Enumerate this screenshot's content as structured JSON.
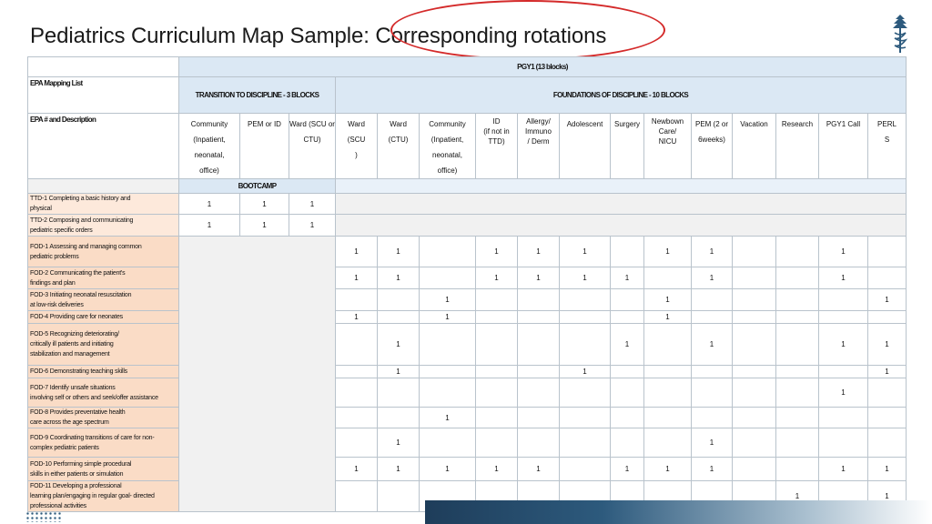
{
  "title": "Pediatrics Curriculum Map Sample: Corresponding rotations",
  "pgy_header": "PGY1 (13 blocks)",
  "epa_mapping_list": "EPA Mapping List",
  "ttd_header": "TRANSITION TO DISCIPLINE - 3 BLOCKS",
  "fod_header": "FOUNDATIONS OF DISCIPLINE - 10 BLOCKS",
  "epa_desc_header": "EPA # and Description",
  "bootcamp": "BOOTCAMP",
  "rotations": [
    {
      "lines": [
        "Community",
        "(Inpatient,",
        "neonatal,",
        "office)"
      ]
    },
    {
      "lines": [
        "PEM or ID"
      ]
    },
    {
      "lines": [
        "Ward (SCU or",
        "CTU)"
      ]
    },
    {
      "lines": [
        "Ward",
        "(SCU",
        ")"
      ]
    },
    {
      "lines": [
        "Ward",
        "(CTU)"
      ]
    },
    {
      "lines": [
        "Community",
        "(Inpatient,",
        "neonatal,",
        "office)"
      ]
    },
    {
      "lines": [
        "ID",
        "(if not in",
        "TTD)"
      ]
    },
    {
      "lines": [
        "Allergy/",
        "Immuno",
        "/ Derm"
      ]
    },
    {
      "lines": [
        "Adolescent"
      ]
    },
    {
      "lines": [
        "Surgery"
      ]
    },
    {
      "lines": [
        "Newbown",
        "Care/",
        "NICU"
      ]
    },
    {
      "lines": [
        "PEM (2 or",
        "6weeks)"
      ]
    },
    {
      "lines": [
        "Vacation"
      ]
    },
    {
      "lines": [
        "Research"
      ]
    },
    {
      "lines": [
        "PGY1 Call"
      ]
    },
    {
      "lines": [
        "PERL",
        "S"
      ]
    }
  ],
  "epas": [
    {
      "desc": [
        "TTD-1 Completing a basic history and",
        "physical"
      ],
      "vals": [
        "1",
        "1",
        "1"
      ]
    },
    {
      "desc": [
        "TTD-2 Composing and communicating",
        "pediatric specific orders"
      ],
      "vals": [
        "1",
        "1",
        "1"
      ]
    },
    {
      "desc": [
        "FOD-1 Assessing and managing common",
        "pediatric problems"
      ],
      "vals": [
        "",
        "",
        "",
        "1",
        "1",
        "",
        "1",
        "1",
        "1",
        "",
        "1",
        "1",
        "",
        "",
        "1",
        ""
      ]
    },
    {
      "desc": [
        "FOD-2 Communicating the patient's",
        "findings and plan"
      ],
      "vals": [
        "",
        "",
        "",
        "1",
        "1",
        "",
        "1",
        "1",
        "1",
        "1",
        "",
        "1",
        "",
        "",
        "1",
        ""
      ]
    },
    {
      "desc": [
        "FOD-3 Initiating neonatal resuscitation",
        "at low-risk deliveries"
      ],
      "vals": [
        "",
        "",
        "",
        "",
        "",
        "1",
        "",
        "",
        "",
        "",
        "1",
        "",
        "",
        "",
        "",
        "1"
      ]
    },
    {
      "desc": [
        "FOD-4 Providing care for neonates"
      ],
      "vals": [
        "",
        "",
        "",
        "1",
        "",
        "1",
        "",
        "",
        "",
        "",
        "1",
        "",
        "",
        "",
        "",
        ""
      ]
    },
    {
      "desc": [
        "FOD-5 Recognizing deteriorating/",
        "critically ill patients and initiating",
        "stabilization and management"
      ],
      "vals": [
        "",
        "",
        "",
        "",
        "1",
        "",
        "",
        "",
        "",
        "1",
        "",
        "1",
        "",
        "",
        "1",
        "1"
      ]
    },
    {
      "desc": [
        "FOD-6 Demonstrating teaching skills"
      ],
      "vals": [
        "",
        "",
        "",
        "",
        "1",
        "",
        "",
        "",
        "1",
        "",
        "",
        "",
        "",
        "",
        "",
        "1"
      ]
    },
    {
      "desc": [
        "FOD-7 Identify unsafe situations",
        "involving self or others and seek/offer assistance"
      ],
      "vals": [
        "",
        "",
        "",
        "",
        "",
        "",
        "",
        "",
        "",
        "",
        "",
        "",
        "",
        "",
        "1",
        ""
      ]
    },
    {
      "desc": [
        "FOD-8 Provides preventative health",
        "care across the age spectrum"
      ],
      "vals": [
        "",
        "",
        "",
        "",
        "",
        "1",
        "",
        "",
        "",
        "",
        "",
        "",
        "",
        "",
        "",
        ""
      ]
    },
    {
      "desc": [
        "FOD-9 Coordinating transitions of care for non-",
        "complex pediatric patients"
      ],
      "vals": [
        "",
        "",
        "",
        "",
        "1",
        "",
        "",
        "",
        "",
        "",
        "",
        "1",
        "",
        "",
        "",
        ""
      ]
    },
    {
      "desc": [
        "FOD-10 Performing simple procedural",
        "skills in either patients or simulation"
      ],
      "vals": [
        "",
        "",
        "",
        "1",
        "1",
        "1",
        "1",
        "1",
        "",
        "1",
        "1",
        "1",
        "",
        "",
        "1",
        "1"
      ]
    },
    {
      "desc": [
        "FOD-11 Developing a professional",
        "learning plan/engaging in regular goal- directed",
        "professional activities"
      ],
      "vals": [
        "",
        "",
        "",
        "",
        "",
        "",
        "",
        "",
        "",
        "",
        "",
        "",
        "",
        "1",
        "",
        "1"
      ]
    }
  ]
}
